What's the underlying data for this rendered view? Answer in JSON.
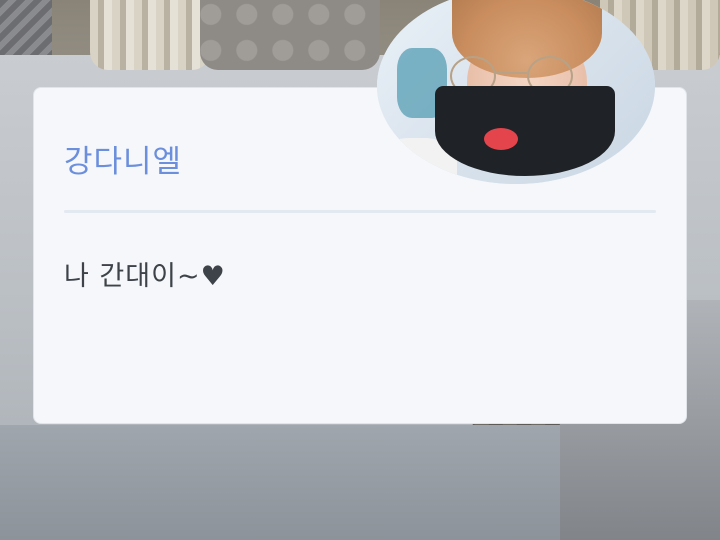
{
  "profile": {
    "name": "강다니엘",
    "status_message": "나 간대이~♥"
  },
  "colors": {
    "name_text": "#6b8fdc",
    "status_text": "#3e4349",
    "card_background": "#f5f7fa",
    "divider": "#e3e9f0"
  },
  "icons": {
    "avatar": "profile-photo"
  }
}
